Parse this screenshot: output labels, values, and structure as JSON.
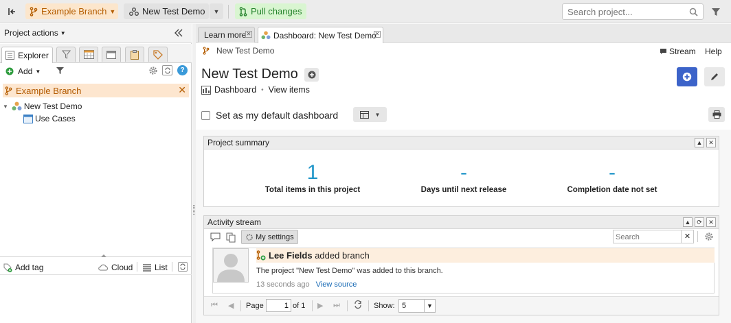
{
  "topbar": {
    "branch_label": "Example Branch",
    "project_label": "New Test Demo",
    "pull_label": "Pull changes",
    "search_placeholder": "Search project..."
  },
  "left": {
    "actions_label": "Project actions",
    "tabs": {
      "explorer": "Explorer"
    },
    "add_label": "Add",
    "branch_name": "Example Branch",
    "tree": [
      {
        "label": "New Test Demo"
      },
      {
        "label": "Use Cases"
      }
    ],
    "bottom": {
      "add_tag": "Add tag",
      "cloud": "Cloud",
      "list": "List"
    }
  },
  "main": {
    "tabs": [
      {
        "label": "Learn more"
      },
      {
        "label": "Dashboard: New Test Demo"
      }
    ],
    "breadcrumb": "New Test Demo",
    "stream_link": "Stream",
    "help_link": "Help",
    "title": "New Test Demo",
    "dashboard_link": "Dashboard",
    "separator": "•",
    "view_items_link": "View items",
    "default_dash_label": "Set as my default dashboard",
    "summary": {
      "title": "Project summary",
      "stats": [
        {
          "value": "1",
          "label": "Total items in this project"
        },
        {
          "value": "-",
          "label": "Days until next release"
        },
        {
          "value": "-",
          "label": "Completion date not set"
        }
      ]
    },
    "activity": {
      "title": "Activity stream",
      "my_settings": "My settings",
      "search_placeholder": "Search",
      "entry": {
        "user": "Lee Fields",
        "action": " added branch",
        "text": "The project \"New Test Demo\" was added to this branch.",
        "time": "13 seconds ago",
        "view_source": "View source"
      },
      "pager": {
        "page_label": "Page",
        "page_value": "1",
        "of_label": "of 1",
        "show_label": "Show:",
        "show_value": "5"
      }
    }
  },
  "colors": {
    "branch": "#b45d00",
    "pull": "#23822a",
    "accent": "#3c63c9",
    "stat": "#2196c9"
  }
}
